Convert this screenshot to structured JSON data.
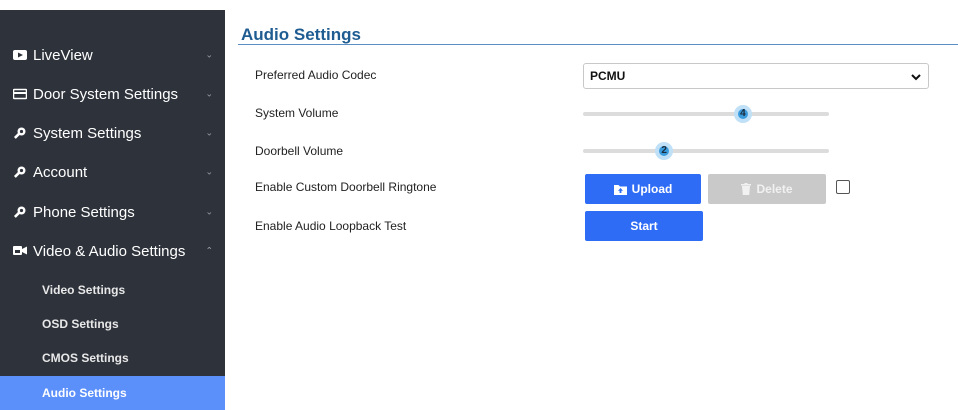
{
  "sidebar": {
    "items": [
      {
        "label": "LiveView",
        "icon": "video-icon",
        "chevron": "⌄"
      },
      {
        "label": "Door System Settings",
        "icon": "door-panel-icon",
        "chevron": "⌄"
      },
      {
        "label": "System Settings",
        "icon": "wrench-icon",
        "chevron": "⌄"
      },
      {
        "label": "Account",
        "icon": "wrench-icon",
        "chevron": "⌄"
      },
      {
        "label": "Phone Settings",
        "icon": "wrench-icon",
        "chevron": "⌄"
      },
      {
        "label": "Video & Audio Settings",
        "icon": "camera-icon",
        "chevron": "⌃"
      }
    ],
    "sub_items": [
      {
        "label": "Video Settings"
      },
      {
        "label": "OSD Settings"
      },
      {
        "label": "CMOS Settings"
      },
      {
        "label": "Audio Settings",
        "active": true
      }
    ]
  },
  "main": {
    "title": "Audio Settings",
    "fields": {
      "codec_label": "Preferred Audio Codec",
      "codec_value": "PCMU",
      "system_volume_label": "System Volume",
      "system_volume_value": "4",
      "system_volume_fraction": 0.65,
      "doorbell_volume_label": "Doorbell Volume",
      "doorbell_volume_value": "2",
      "doorbell_volume_fraction": 0.33,
      "ringtone_label": "Enable Custom Doorbell Ringtone",
      "upload_label": "Upload",
      "delete_label": "Delete",
      "loopback_label": "Enable Audio Loopback Test",
      "start_label": "Start"
    }
  },
  "colors": {
    "sidebar_bg": "#2e323b",
    "active_item": "#5b8ff9",
    "title": "#1f5c91",
    "primary_button": "#2f6cf6",
    "disabled_button": "#c9c9c9"
  }
}
